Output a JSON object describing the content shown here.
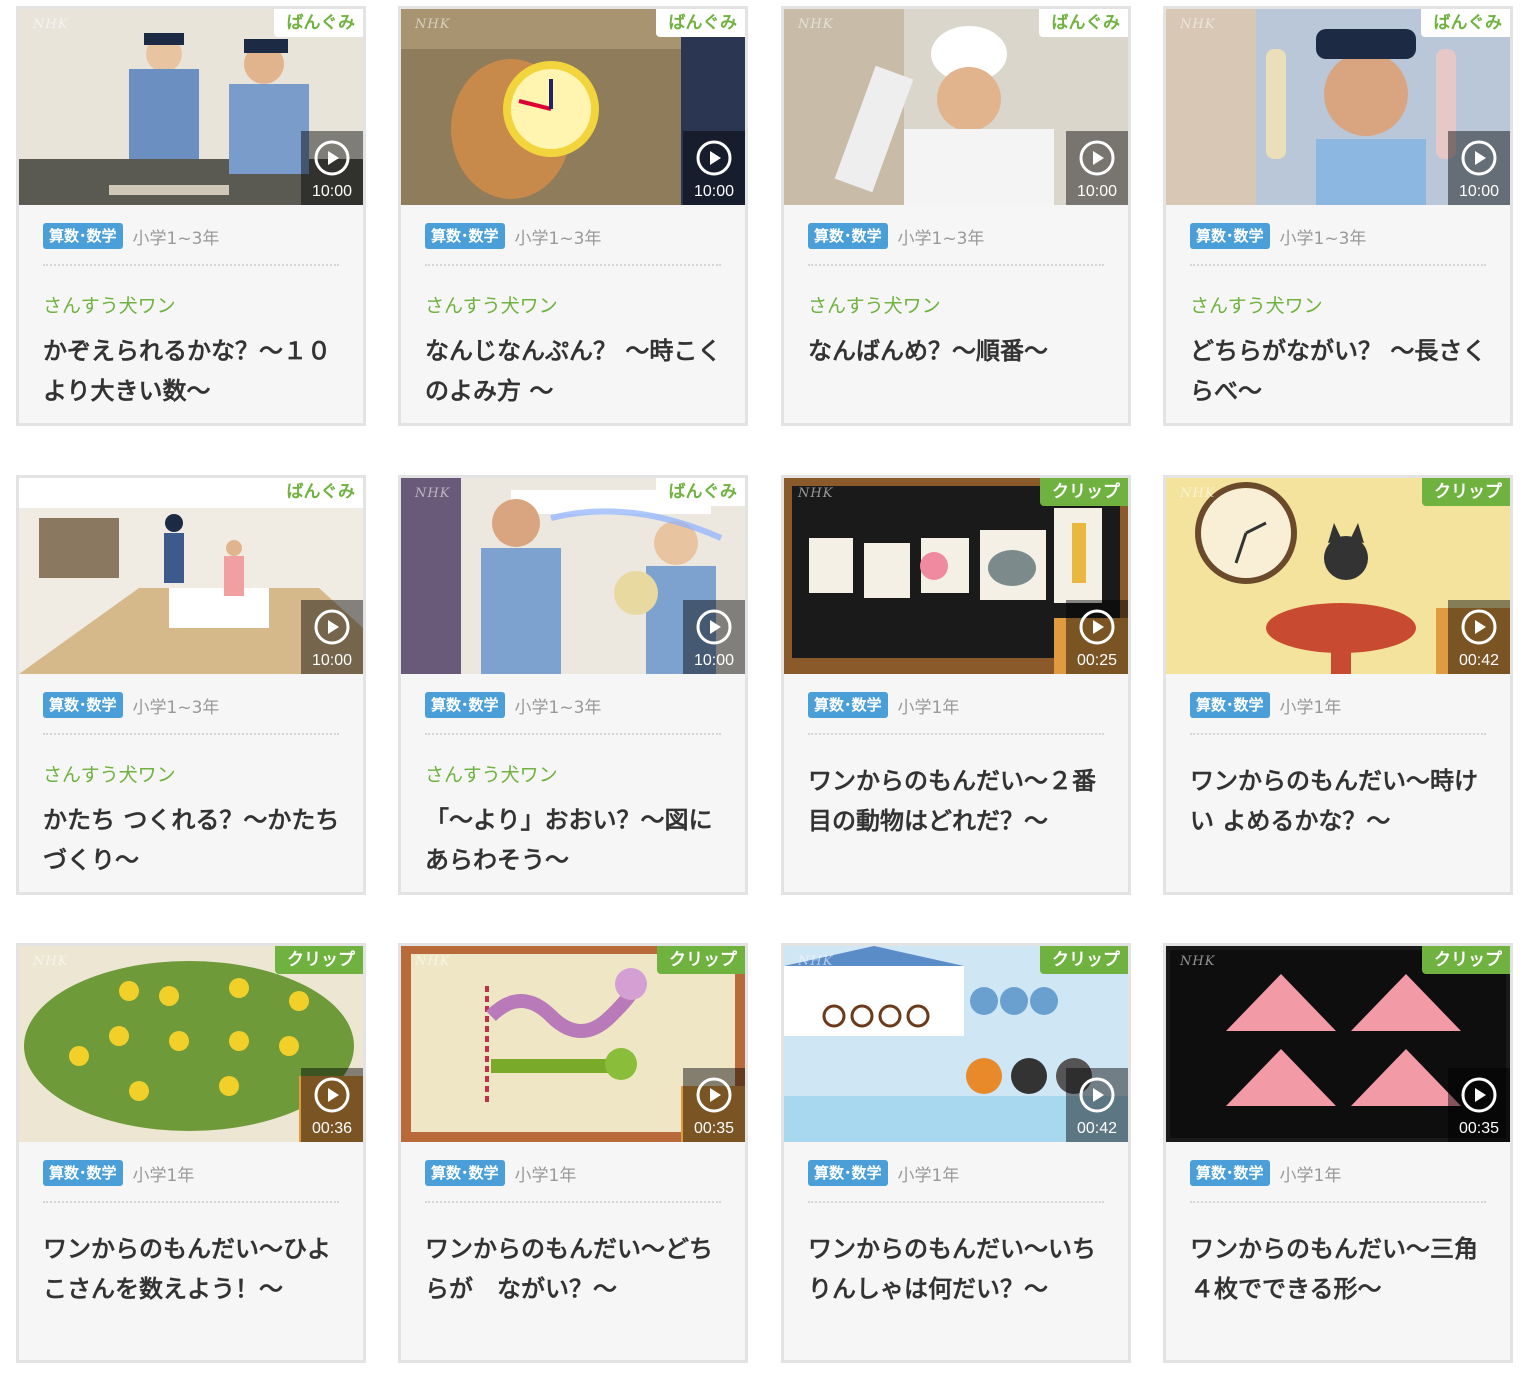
{
  "cards": [
    {
      "badge": "ばんぐみ",
      "badge_type": "program",
      "duration": "10:00",
      "subject": "算数･数学",
      "grade": "小学1~3年",
      "series": "さんすう犬ワン",
      "title": "かぞえられるかな？〜１０より大きい数〜"
    },
    {
      "badge": "ばんぐみ",
      "badge_type": "program",
      "duration": "10:00",
      "subject": "算数･数学",
      "grade": "小学1~3年",
      "series": "さんすう犬ワン",
      "title": "なんじなんぷん？ 〜時こくのよみ方 〜"
    },
    {
      "badge": "ばんぐみ",
      "badge_type": "program",
      "duration": "10:00",
      "subject": "算数･数学",
      "grade": "小学1~3年",
      "series": "さんすう犬ワン",
      "title": "なんばんめ？〜順番〜"
    },
    {
      "badge": "ばんぐみ",
      "badge_type": "program",
      "duration": "10:00",
      "subject": "算数･数学",
      "grade": "小学1~3年",
      "series": "さんすう犬ワン",
      "title": "どちらがながい？ 〜長さくらべ〜"
    },
    {
      "badge": "ばんぐみ",
      "badge_type": "program",
      "duration": "10:00",
      "subject": "算数･数学",
      "grade": "小学1~3年",
      "series": "さんすう犬ワン",
      "title": "かたち つくれる？〜かたちづくり〜"
    },
    {
      "badge": "ばんぐみ",
      "badge_type": "program",
      "duration": "10:00",
      "subject": "算数･数学",
      "grade": "小学1~3年",
      "series": "さんすう犬ワン",
      "title": "「〜より」おおい？〜図にあらわそう〜"
    },
    {
      "badge": "クリップ",
      "badge_type": "clip",
      "duration": "00:25",
      "subject": "算数･数学",
      "grade": "小学1年",
      "series": "",
      "title": "ワンからのもんだい〜２番目の動物はどれだ？〜"
    },
    {
      "badge": "クリップ",
      "badge_type": "clip",
      "duration": "00:42",
      "subject": "算数･数学",
      "grade": "小学1年",
      "series": "",
      "title": "ワンからのもんだい〜時けい よめるかな？〜"
    },
    {
      "badge": "クリップ",
      "badge_type": "clip",
      "duration": "00:36",
      "subject": "算数･数学",
      "grade": "小学1年",
      "series": "",
      "title": "ワンからのもんだい〜ひよこさんを数えよう！〜"
    },
    {
      "badge": "クリップ",
      "badge_type": "clip",
      "duration": "00:35",
      "subject": "算数･数学",
      "grade": "小学1年",
      "series": "",
      "title": "ワンからのもんだい〜どちらが　ながい？〜"
    },
    {
      "badge": "クリップ",
      "badge_type": "clip",
      "duration": "00:42",
      "subject": "算数･数学",
      "grade": "小学1年",
      "series": "",
      "title": "ワンからのもんだい〜いちりんしゃは何だい？〜"
    },
    {
      "badge": "クリップ",
      "badge_type": "clip",
      "duration": "00:35",
      "subject": "算数･数学",
      "grade": "小学1年",
      "series": "",
      "title": "ワンからのもんだい〜三角４枚でできる形〜"
    }
  ],
  "nhk_logo": "NHK",
  "colors": {
    "badge_green": "#6fb23f",
    "subject_blue": "#4a9fd8"
  },
  "icons": {
    "play": "play-circle-icon"
  }
}
